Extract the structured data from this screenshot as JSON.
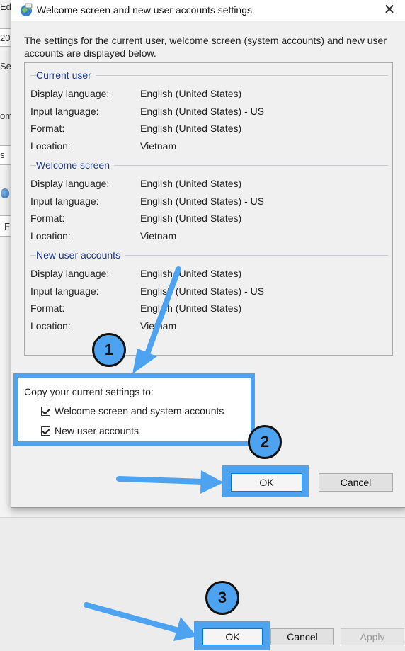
{
  "background": {
    "fragments": [
      "Ed",
      "20",
      "Se",
      "om",
      "s",
      "F"
    ],
    "buttons": {
      "ok": "OK",
      "cancel": "Cancel",
      "apply": "Apply"
    }
  },
  "dialog": {
    "title": "Welcome screen and new user accounts settings",
    "close_label": "✕",
    "intro": "The settings for the current user, welcome screen (system accounts) and new user accounts are displayed below.",
    "sections": [
      {
        "title": "Current user",
        "rows": [
          {
            "label": "Display language:",
            "value": "English (United States)"
          },
          {
            "label": "Input language:",
            "value": "English (United States) - US"
          },
          {
            "label": "Format:",
            "value": "English (United States)"
          },
          {
            "label": "Location:",
            "value": "Vietnam"
          }
        ]
      },
      {
        "title": "Welcome screen",
        "rows": [
          {
            "label": "Display language:",
            "value": "English (United States)"
          },
          {
            "label": "Input language:",
            "value": "English (United States) - US"
          },
          {
            "label": "Format:",
            "value": "English (United States)"
          },
          {
            "label": "Location:",
            "value": "Vietnam"
          }
        ]
      },
      {
        "title": "New user accounts",
        "rows": [
          {
            "label": "Display language:",
            "value": "English (United States)"
          },
          {
            "label": "Input language:",
            "value": "English (United States) - US"
          },
          {
            "label": "Format:",
            "value": "English (United States)"
          },
          {
            "label": "Location:",
            "value": "Vietnam"
          }
        ]
      }
    ],
    "copy": {
      "title": "Copy your current settings to:",
      "options": [
        {
          "label": "Welcome screen and system accounts",
          "checked": true
        },
        {
          "label": "New user accounts",
          "checked": true
        }
      ]
    },
    "buttons": {
      "ok": "OK",
      "cancel": "Cancel"
    }
  },
  "annotations": {
    "step1": "1",
    "step2": "2",
    "step3": "3",
    "color": "#4da3ef"
  }
}
